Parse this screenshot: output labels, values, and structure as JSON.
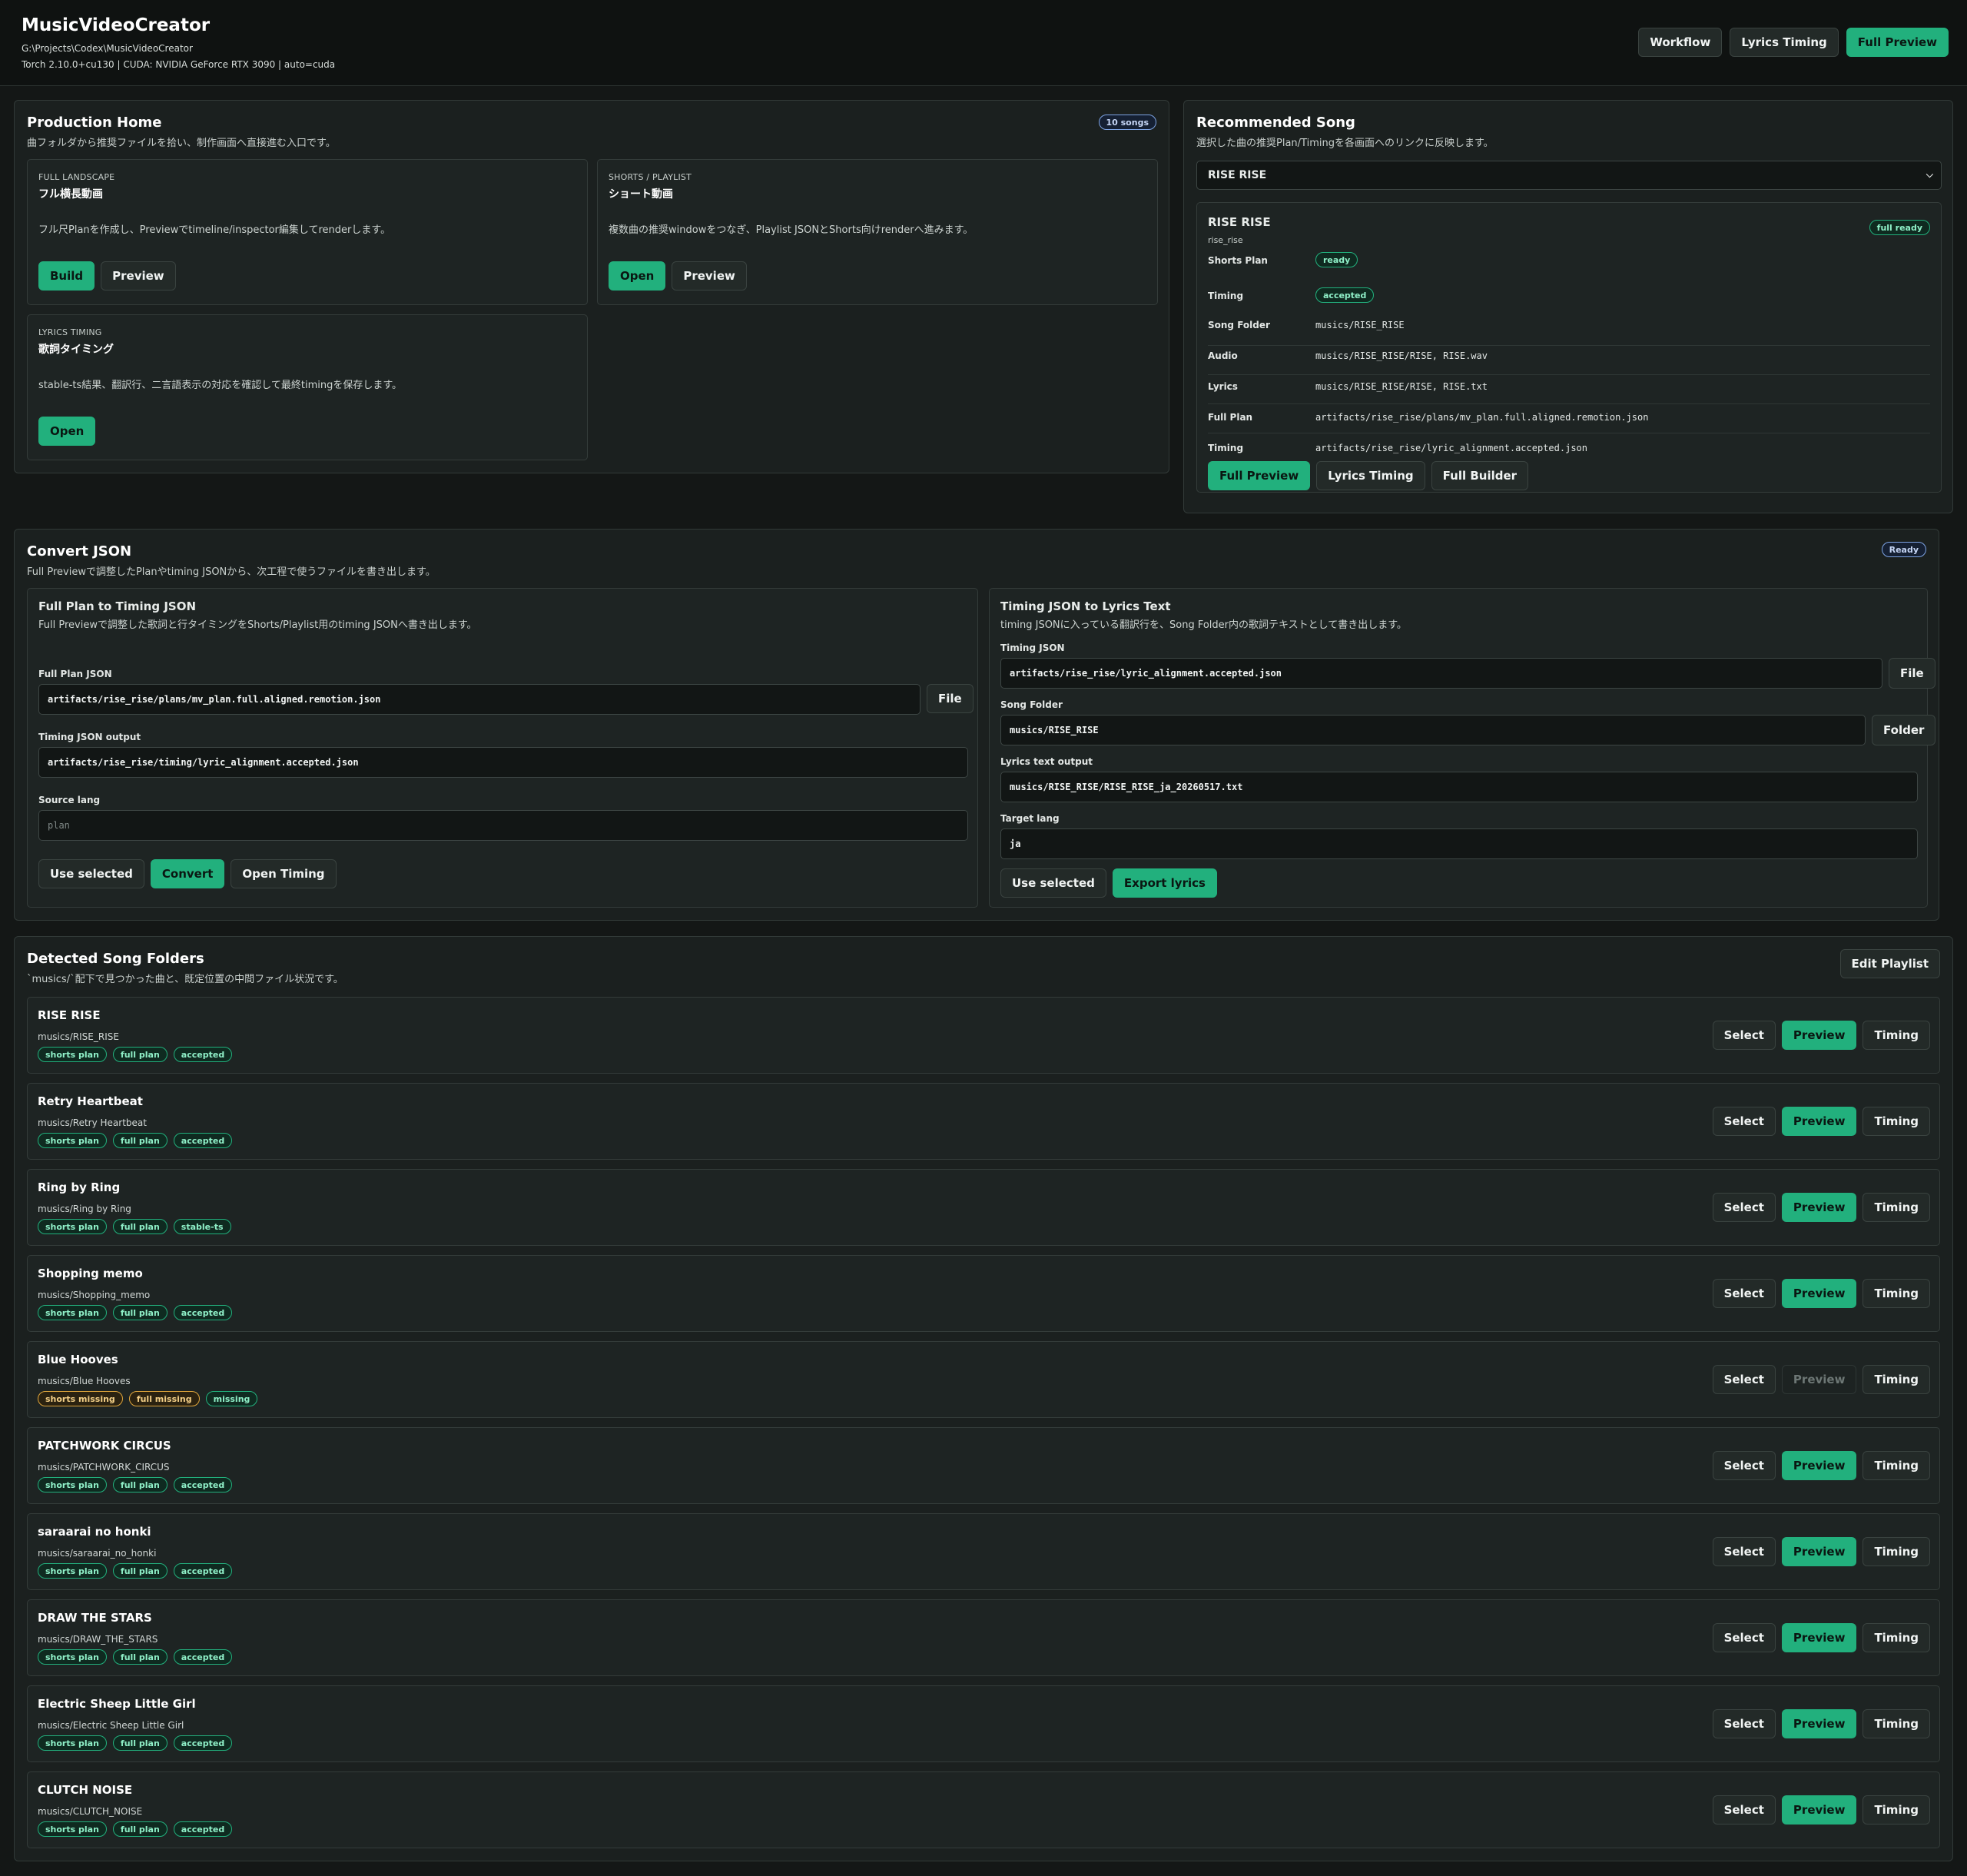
{
  "app": {
    "title": "MusicVideoCreator",
    "path": "G:\\Projects\\Codex\\MusicVideoCreator",
    "env": "Torch 2.10.0+cu130 | CUDA: NVIDIA GeForce RTX 3090 | auto=cuda"
  },
  "top_nav": [
    "Workflow",
    "Lyrics Timing",
    "Full Preview"
  ],
  "production_home": {
    "title": "Production Home",
    "subtitle": "曲フォルダから推奨ファイルを拾い、制作画面へ直接進む入口です。",
    "badge": "10 songs",
    "cards": [
      {
        "kicker": "FULL LANDSCAPE",
        "title": "フル横長動画",
        "desc": "フル尺Planを作成し、Previewでtimeline/inspector編集してrenderします。",
        "buttons": [
          "Build",
          "Preview"
        ]
      },
      {
        "kicker": "SHORTS / PLAYLIST",
        "title": "ショート動画",
        "desc": "複数曲の推奨windowをつなぎ、Playlist JSONとShorts向けrenderへ進みます。",
        "buttons": [
          "Open",
          "Preview"
        ]
      },
      {
        "kicker": "LYRICS TIMING",
        "title": "歌詞タイミング",
        "desc": "stable-ts結果、翻訳行、二言語表示の対応を確認して最終timingを保存します。",
        "buttons": [
          "Open"
        ]
      }
    ]
  },
  "recommended": {
    "title": "Recommended Song",
    "subtitle": "選択した曲の推奨Plan/Timingを各画面へのリンクに反映します。",
    "selected": "RISE RISE",
    "song_title": "RISE RISE",
    "song_id": "rise_rise",
    "status": "full ready",
    "rows": [
      {
        "k": "Shorts Plan",
        "pill": "ready"
      },
      {
        "k": "Timing",
        "pill": "accepted"
      },
      {
        "k": "Song Folder",
        "v": "musics/RISE_RISE"
      },
      {
        "k": "Audio",
        "v": "musics/RISE_RISE/RISE, RISE.wav"
      },
      {
        "k": "Lyrics",
        "v": "musics/RISE_RISE/RISE, RISE.txt"
      },
      {
        "k": "Full Plan",
        "v": "artifacts/rise_rise/plans/mv_plan.full.aligned.remotion.json"
      },
      {
        "k": "Timing",
        "v": "artifacts/rise_rise/lyric_alignment.accepted.json"
      }
    ],
    "buttons": [
      "Full Preview",
      "Lyrics Timing",
      "Full Builder"
    ]
  },
  "convert": {
    "title": "Convert JSON",
    "subtitle": "Full Previewで調整したPlanやtiming JSONから、次工程で使うファイルを書き出します。",
    "badge": "Ready",
    "left": {
      "title": "Full Plan to Timing JSON",
      "subtitle": "Full Previewで調整した歌詞と行タイミングをShorts/Playlist用のtiming JSONへ書き出します。",
      "plan_label": "Full Plan JSON",
      "plan_value": "artifacts/rise_rise/plans/mv_plan.full.aligned.remotion.json",
      "file_btn": "File",
      "out_label": "Timing JSON output",
      "out_value": "artifacts/rise_rise/timing/lyric_alignment.accepted.json",
      "src_label": "Source lang",
      "src_placeholder": "plan",
      "buttons": [
        "Use selected",
        "Convert",
        "Open Timing"
      ]
    },
    "right": {
      "title": "Timing JSON to Lyrics Text",
      "subtitle": "timing JSONに入っている翻訳行を、Song Folder内の歌詞テキストとして書き出します。",
      "timing_label": "Timing JSON",
      "timing_value": "artifacts/rise_rise/lyric_alignment.accepted.json",
      "file_btn": "File",
      "folder_label": "Song Folder",
      "folder_value": "musics/RISE_RISE",
      "folder_btn": "Folder",
      "out_label": "Lyrics text output",
      "out_value": "musics/RISE_RISE/RISE_RISE_ja_20260517.txt",
      "target_label": "Target lang",
      "target_value": "ja",
      "buttons": [
        "Use selected",
        "Export lyrics"
      ]
    }
  },
  "detected": {
    "title": "Detected Song Folders",
    "subtitle": "`musics/`配下で見つかった曲と、既定位置の中間ファイル状況です。",
    "edit_btn": "Edit Playlist",
    "row_buttons": [
      "Select",
      "Preview",
      "Timing"
    ],
    "songs": [
      {
        "name": "RISE RISE",
        "path": "musics/RISE_RISE",
        "tags": [
          [
            "shorts plan",
            "green"
          ],
          [
            "full plan",
            "green"
          ],
          [
            "accepted",
            "green"
          ]
        ],
        "preview": true
      },
      {
        "name": "Retry Heartbeat",
        "path": "musics/Retry Heartbeat",
        "tags": [
          [
            "shorts plan",
            "green"
          ],
          [
            "full plan",
            "green"
          ],
          [
            "accepted",
            "green"
          ]
        ],
        "preview": true
      },
      {
        "name": "Ring by Ring",
        "path": "musics/Ring by Ring",
        "tags": [
          [
            "shorts plan",
            "green"
          ],
          [
            "full plan",
            "green"
          ],
          [
            "stable-ts",
            "green"
          ]
        ],
        "preview": true
      },
      {
        "name": "Shopping memo",
        "path": "musics/Shopping_memo",
        "tags": [
          [
            "shorts plan",
            "green"
          ],
          [
            "full plan",
            "green"
          ],
          [
            "accepted",
            "green"
          ]
        ],
        "preview": true
      },
      {
        "name": "Blue Hooves",
        "path": "musics/Blue Hooves",
        "tags": [
          [
            "shorts missing",
            "amber"
          ],
          [
            "full missing",
            "amber"
          ],
          [
            "missing",
            "green"
          ]
        ],
        "preview": false
      },
      {
        "name": "PATCHWORK CIRCUS",
        "path": "musics/PATCHWORK_CIRCUS",
        "tags": [
          [
            "shorts plan",
            "green"
          ],
          [
            "full plan",
            "green"
          ],
          [
            "accepted",
            "green"
          ]
        ],
        "preview": true
      },
      {
        "name": "saraarai no honki",
        "path": "musics/saraarai_no_honki",
        "tags": [
          [
            "shorts plan",
            "green"
          ],
          [
            "full plan",
            "green"
          ],
          [
            "accepted",
            "green"
          ]
        ],
        "preview": true
      },
      {
        "name": "DRAW THE STARS",
        "path": "musics/DRAW_THE_STARS",
        "tags": [
          [
            "shorts plan",
            "green"
          ],
          [
            "full plan",
            "green"
          ],
          [
            "accepted",
            "green"
          ]
        ],
        "preview": true
      },
      {
        "name": "Electric Sheep Little Girl",
        "path": "musics/Electric Sheep Little Girl",
        "tags": [
          [
            "shorts plan",
            "green"
          ],
          [
            "full plan",
            "green"
          ],
          [
            "accepted",
            "green"
          ]
        ],
        "preview": true
      },
      {
        "name": "CLUTCH NOISE",
        "path": "musics/CLUTCH_NOISE",
        "tags": [
          [
            "shorts plan",
            "green"
          ],
          [
            "full plan",
            "green"
          ],
          [
            "accepted",
            "green"
          ]
        ],
        "preview": true
      }
    ]
  }
}
